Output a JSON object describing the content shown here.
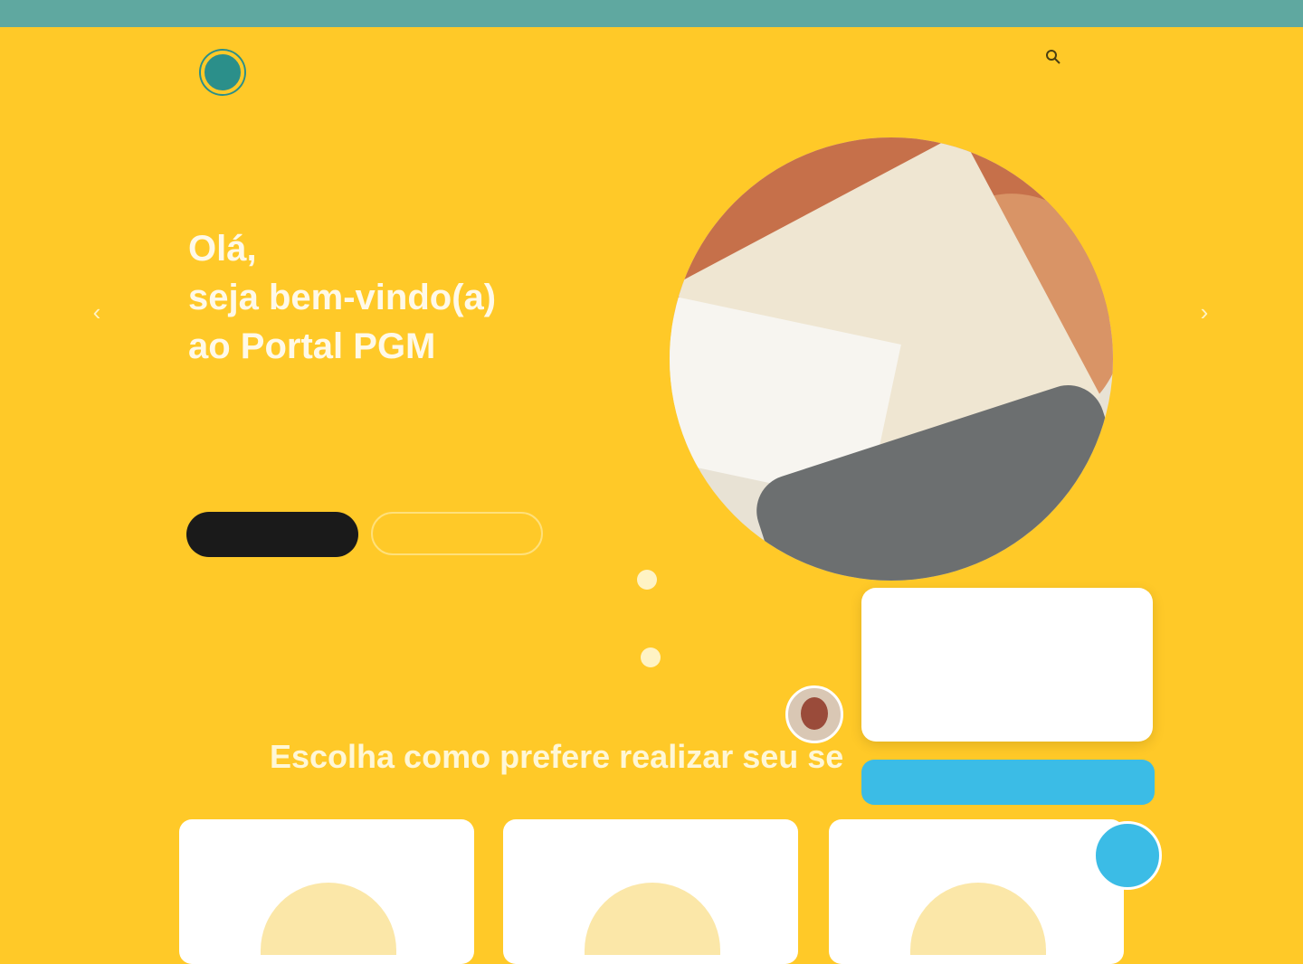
{
  "topbar": {
    "links": [
      "",
      "",
      "",
      "",
      "",
      "",
      ""
    ]
  },
  "header": {
    "logo_brand": "",
    "logo_tagline": "",
    "nav": [
      "",
      "",
      "",
      "",
      "",
      ""
    ]
  },
  "hero": {
    "title_lines": [
      "Olá,",
      "seja bem-vindo(a)",
      "ao Portal PGM"
    ],
    "description": "",
    "primary_button": "",
    "secondary_button": ""
  },
  "section": {
    "kicker": "",
    "title": "Escolha como prefere realizar seu se"
  },
  "chat": {
    "popup_title": "",
    "popup_text": "",
    "button_label": ""
  },
  "colors": {
    "page_background": "#ffc928",
    "topbar": "#5fa8a0",
    "chat_accent": "#3bbce6"
  }
}
